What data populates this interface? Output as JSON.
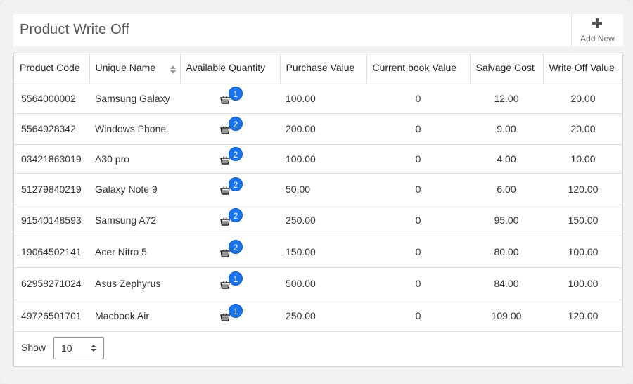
{
  "page": {
    "title": "Product Write Off",
    "add_new_label": "Add New"
  },
  "table": {
    "columns": [
      "Product Code",
      "Unique Name",
      "Available Quantity",
      "Purchase Value",
      "Current book Value",
      "Salvage Cost",
      "Write Off Value"
    ],
    "rows": [
      {
        "code": "5564000002",
        "name": "Samsung Galaxy",
        "qty": "1",
        "purchase": "100.00",
        "book": "0",
        "salvage": "12.00",
        "writeoff": "20.00"
      },
      {
        "code": "5564928342",
        "name": "Windows Phone",
        "qty": "2",
        "purchase": "200.00",
        "book": "0",
        "salvage": "9.00",
        "writeoff": "20.00"
      },
      {
        "code": "03421863019",
        "name": "A30 pro",
        "qty": "2",
        "purchase": "100.00",
        "book": "0",
        "salvage": "4.00",
        "writeoff": "10.00"
      },
      {
        "code": "51279840219",
        "name": "Galaxy Note 9",
        "qty": "2",
        "purchase": "50.00",
        "book": "0",
        "salvage": "6.00",
        "writeoff": "120.00"
      },
      {
        "code": "91540148593",
        "name": "Samsung A72",
        "qty": "2",
        "purchase": "250.00",
        "book": "0",
        "salvage": "95.00",
        "writeoff": "150.00"
      },
      {
        "code": "19064502141",
        "name": "Acer Nitro 5",
        "qty": "2",
        "purchase": "150.00",
        "book": "0",
        "salvage": "80.00",
        "writeoff": "100.00"
      },
      {
        "code": "62958271024",
        "name": "Asus Zephyrus",
        "qty": "1",
        "purchase": "500.00",
        "book": "0",
        "salvage": "84.00",
        "writeoff": "100.00"
      },
      {
        "code": "49726501701",
        "name": "Macbook Air",
        "qty": "1",
        "purchase": "250.00",
        "book": "0",
        "salvage": "109.00",
        "writeoff": "120.00"
      }
    ],
    "quantity_icon": "basket-icon",
    "sort_icon": "sort-icon"
  },
  "footer": {
    "show_label": "Show",
    "page_size": "10"
  },
  "colors": {
    "badge": "#1a73e8",
    "background": "#f2f2f2"
  }
}
